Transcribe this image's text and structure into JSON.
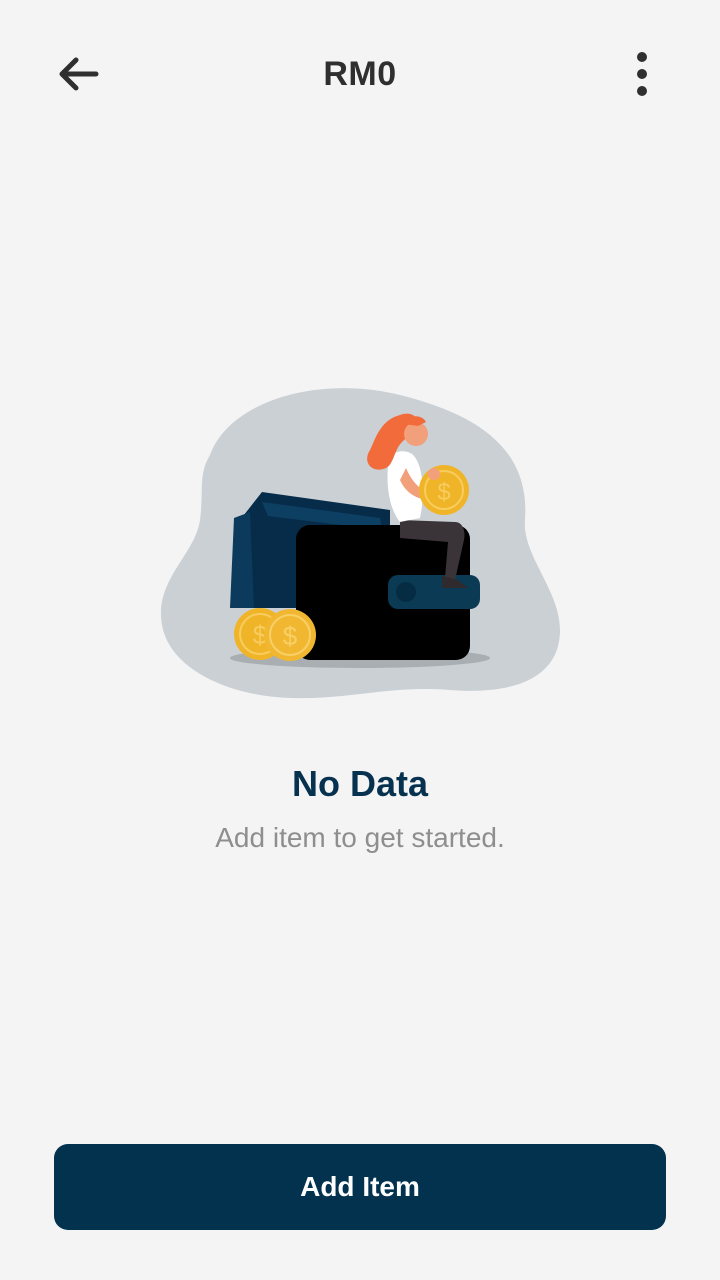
{
  "header": {
    "title": "RM0",
    "back_icon": "arrow-left-icon",
    "more_icon": "more-vertical-icon"
  },
  "empty_state": {
    "illustration": "wallet-with-coins-illustration",
    "title": "No Data",
    "subtitle": "Add item to get started."
  },
  "actions": {
    "add_label": "Add Item"
  },
  "colors": {
    "background": "#f4f4f4",
    "primary": "#03324f",
    "title_text": "#2f2f2f",
    "empty_title": "#07324f",
    "subtitle_text": "#8e8e8e",
    "coin": "#f0b429",
    "hair": "#f26b3a"
  }
}
